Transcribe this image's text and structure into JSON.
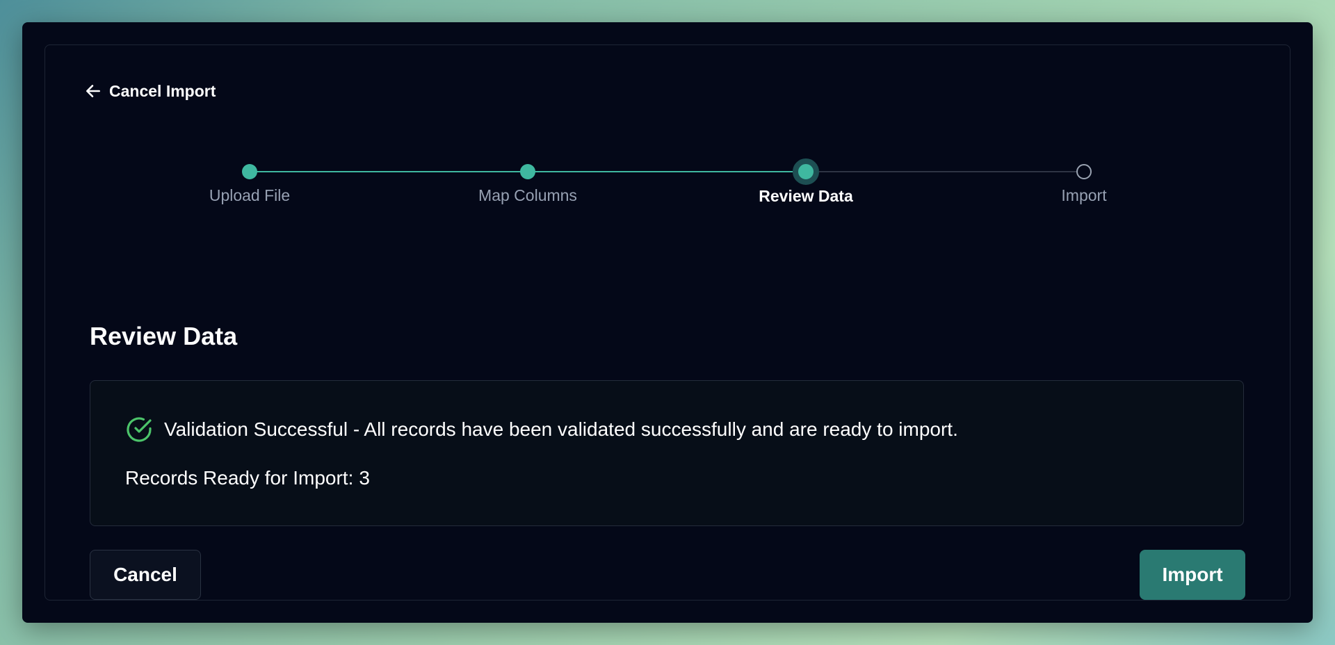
{
  "nav": {
    "back_label": "Cancel Import",
    "back_icon": "arrow-left-icon"
  },
  "stepper": {
    "steps": [
      {
        "label": "Upload File",
        "status": "completed"
      },
      {
        "label": "Map Columns",
        "status": "completed"
      },
      {
        "label": "Review Data",
        "status": "current"
      },
      {
        "label": "Import",
        "status": "upcoming"
      }
    ],
    "active_color": "#3fb8a0",
    "inactive_color": "#9aa3b2"
  },
  "review": {
    "title": "Review Data",
    "validation_icon": "check-circle-icon",
    "validation_message": "Validation Successful - All records have been validated successfully and are ready to import.",
    "records_label": "Records Ready for Import:",
    "records_count": "3",
    "success_color": "#4cc46a"
  },
  "actions": {
    "cancel_label": "Cancel",
    "import_label": "Import",
    "import_color": "#2a7a72"
  }
}
